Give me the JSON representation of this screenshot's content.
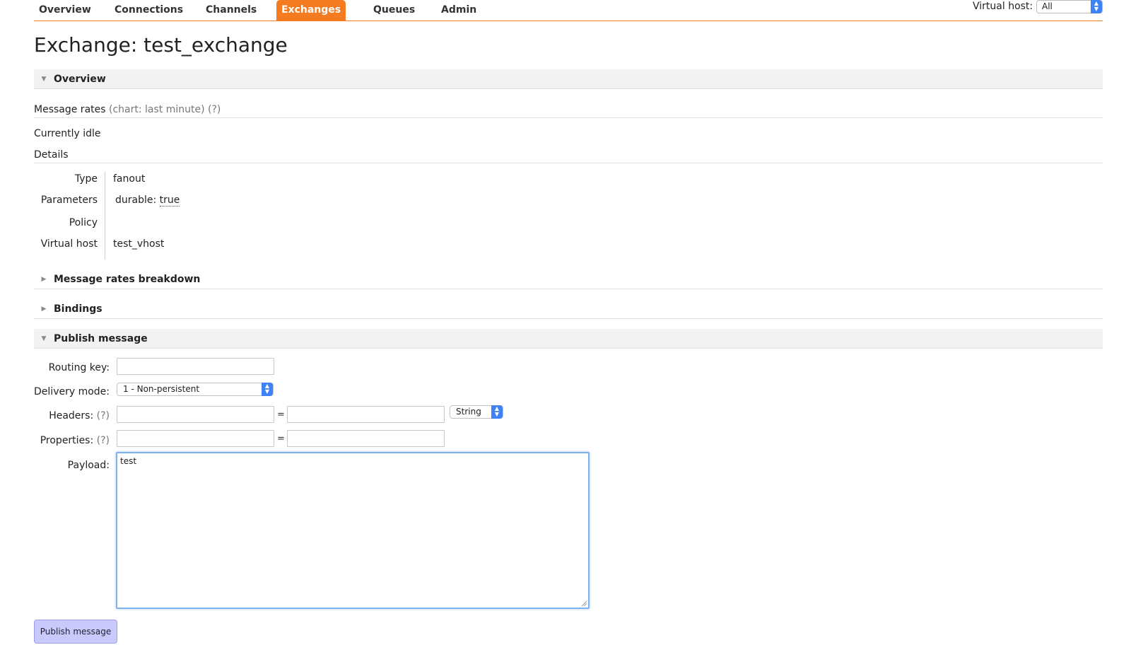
{
  "nav": {
    "tabs": [
      {
        "label": "Overview"
      },
      {
        "label": "Connections"
      },
      {
        "label": "Channels"
      },
      {
        "label": "Exchanges",
        "active": true
      },
      {
        "label": "Queues"
      },
      {
        "label": "Admin"
      }
    ],
    "vhost_label": "Virtual host:",
    "vhost_value": "All"
  },
  "page": {
    "title": "Exchange: test_exchange"
  },
  "overview": {
    "header": "Overview",
    "message_rates_label": "Message rates",
    "message_rates_help": "(chart: last minute) (?)",
    "status": "Currently idle",
    "details_label": "Details",
    "details": {
      "type_label": "Type",
      "type_value": "fanout",
      "parameters_label": "Parameters",
      "parameters_key": "durable:",
      "parameters_value": "true",
      "policy_label": "Policy",
      "policy_value": "",
      "vhost_label": "Virtual host",
      "vhost_value": "test_vhost"
    }
  },
  "sections": {
    "breakdown": "Message rates breakdown",
    "bindings": "Bindings",
    "publish": "Publish message"
  },
  "publish_form": {
    "routing_key_label": "Routing key:",
    "routing_key_value": "",
    "delivery_mode_label": "Delivery mode:",
    "delivery_mode_value": "1 - Non-persistent",
    "headers_label": "Headers:",
    "headers_help": "(?)",
    "headers_type": "String",
    "properties_label": "Properties:",
    "properties_help": "(?)",
    "equals": "=",
    "payload_label": "Payload:",
    "payload_value": "test",
    "submit_label": "Publish message"
  },
  "colors": {
    "accent": "#f47b20",
    "button": "#c9c9fb",
    "focus": "#7fb2ef"
  }
}
